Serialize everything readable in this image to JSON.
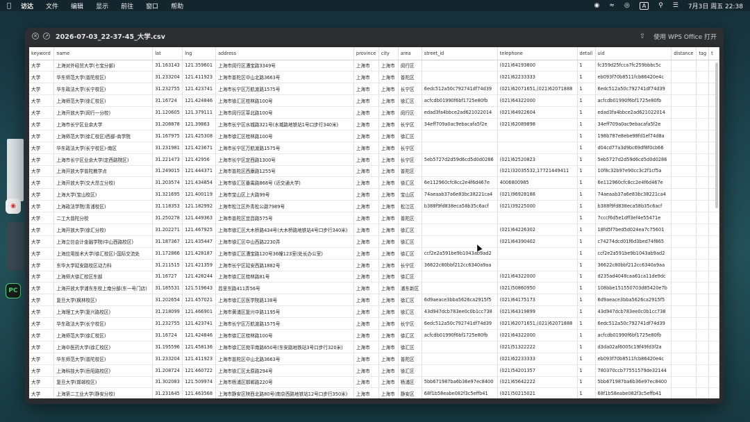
{
  "menubar": {
    "app": "访达",
    "items": [
      "文件",
      "编辑",
      "显示",
      "前往",
      "窗口",
      "帮助"
    ],
    "ime": "A",
    "clock": "7月3日 周五  22:38"
  },
  "window": {
    "title": "2026-07-03_22-37-45_大学.csv",
    "open_with": "使用 WPS Office 打开"
  },
  "table": {
    "columns": [
      "keyword",
      "name",
      "lat",
      "lng",
      "address",
      "province",
      "city",
      "area",
      "street_id",
      "telephone",
      "detail",
      "uid",
      "distance",
      "tag",
      "t"
    ],
    "rows": [
      [
        "大学",
        "上海对外经贸大学(七宝分部)",
        "31.163143",
        "121.359601",
        "上海市闵行区漕宝路3349号",
        "上海市",
        "上海市",
        "闵行区",
        "",
        "(021)64193800",
        "1",
        "fc359d25fcca7fc259bbbc5c",
        "",
        "",
        ""
      ],
      [
        "大学",
        "华东师范大学(普陀校区)",
        "31.233204",
        "121.411923",
        "上海市普陀区中山北路3663号",
        "上海市",
        "上海市",
        "普陀区",
        "",
        "(021)62233333",
        "1",
        "eb093f70b8511fcb86420e4c",
        "",
        "",
        ""
      ],
      [
        "大学",
        "华东政法大学(长宁校区)",
        "31.232755",
        "121.423741",
        "上海市长宁区万航渡路1575号",
        "上海市",
        "上海市",
        "长宁区",
        "6edc512a50c792741df74d39",
        "(021)62071651,(021)62071888",
        "1",
        "6edc512a50c792741df74d39",
        "",
        "",
        ""
      ],
      [
        "大学",
        "上海师范大学(徐汇校区)",
        "31.16724",
        "121.424846",
        "上海市徐汇区桂林路100号",
        "上海市",
        "上海市",
        "徐汇区",
        "acfcdb01990f6bf1725e80fb",
        "(021)64322000",
        "1",
        "acfcdb01990f6bf1725e80fb",
        "",
        "",
        ""
      ],
      [
        "大学",
        "上海开放大学(闵行一分校)",
        "31.120605",
        "121.379111",
        "上海市闵行区莘北路100号",
        "上海市",
        "上海市",
        "闵行区",
        "edad3fa4bbce2ad621022014",
        "(021)64922604",
        "1",
        "edad3fa4bbce2ad621022014",
        "",
        "",
        ""
      ],
      [
        "大学",
        "上海市长宁区业余大学",
        "31.208878",
        "121.39863",
        "上海市长宁区水城路321号(水城路地铁站1号口步行340米)",
        "上海市",
        "上海市",
        "长宁区",
        "34eff709a0ac9ebacafa5f2e",
        "(021)62089898",
        "1",
        "34eff709a0ac9ebacafa5f2e",
        "",
        "",
        ""
      ],
      [
        "大学",
        "上海师范大学(徐汇校区)西部-商学院",
        "31.167975",
        "121.425308",
        "上海市徐汇区桂林路100号",
        "上海市",
        "上海市",
        "徐汇区",
        "",
        "",
        "1",
        "198b787e8ebe98fd1ef74d8a",
        "",
        "",
        ""
      ],
      [
        "大学",
        "华东政法大学(长宁校区)-南区",
        "31.231981",
        "121.423671",
        "上海市长宁区万航渡路1575号",
        "上海市",
        "上海市",
        "长宁区",
        "",
        "",
        "1",
        "d04cd77a3d9bc69df8f0cb66",
        "",
        "",
        ""
      ],
      [
        "大学",
        "上海市长宁区业余大学(定西路院区)",
        "31.221473",
        "121.42956",
        "上海市长宁区定西路1300号",
        "上海市",
        "上海市",
        "长宁区",
        "5eb5727d2d59d6cd5d0d0286",
        "(021)62520823",
        "1",
        "5eb5727d2d59d6cd5d0d0286",
        "",
        "",
        ""
      ],
      [
        "大学",
        "上海开放大学普陀教学点",
        "31.249015",
        "121.444371",
        "上海市普陀区西康路1255号",
        "上海市",
        "上海市",
        "普陀区",
        "",
        "(021)32035532,17721449411",
        "1",
        "10f8c32b97e90cc3c2f1cf5a",
        "",
        "",
        ""
      ],
      [
        "大学",
        "上海开放大学(交大昂立分校)",
        "31.203574",
        "121.434854",
        "上海市徐汇区番禺路868号 (近交通大学)",
        "上海市",
        "上海市",
        "徐汇区",
        "6e112960cfc8cc2e4f6d467e",
        "4006800985",
        "1",
        "6e112960cfc8cc2e4f6d467e",
        "",
        "",
        ""
      ],
      [
        "大学",
        "上海大学(宝山校区)",
        "31.321695",
        "121.400119",
        "上海市宝山区上大路99号",
        "上海市",
        "上海市",
        "宝山区",
        "74aeaab37a6e83bc38221ca4",
        "(021)96928188",
        "1",
        "74aeaab37a6e83bc38221ca4",
        "",
        "",
        ""
      ],
      [
        "大学",
        "上海政法学院(青浦校区)",
        "31.118353",
        "121.182992",
        "上海市松江区外青松公路7989号",
        "上海市",
        "上海市",
        "松江区",
        "b388f9fd838eca58b35c6acf",
        "(021)39225000",
        "1",
        "b388f9fd838eca58b35c6acf",
        "",
        "",
        ""
      ],
      [
        "大学",
        "二工大普陀分校",
        "31.250278",
        "121.449363",
        "上海市普陀区宜昌路575号",
        "上海市",
        "上海市",
        "普陀区",
        "",
        "",
        "1",
        "7cccf6d5e1dff3ef4e55471e",
        "",
        "",
        ""
      ],
      [
        "大学",
        "上海开放大学(徐汇分校)",
        "31.202271",
        "121.467925",
        "上海市徐汇区大木桥路434号(大木桥路地铁站4号口步行340米)",
        "上海市",
        "上海市",
        "徐汇区",
        "",
        "(021)64226302",
        "1",
        "18fd5f7bed5d024ea7c75601",
        "",
        "",
        ""
      ],
      [
        "大学",
        "上海立信会计金融学院(中山西路校区)",
        "31.187367",
        "121.435447",
        "上海市徐汇区中山西路2230弄",
        "上海市",
        "上海市",
        "徐汇区",
        "",
        "(021)64390402",
        "1",
        "c74274dcd01f6d3bed74f865",
        "",
        "",
        ""
      ],
      [
        "大学",
        "上海应用技术大学(徐汇校区)-国际交流处",
        "31.172866",
        "121.428187",
        "上海市徐汇区漕宝路120号36幢123室(处长办公室)",
        "上海市",
        "上海市",
        "徐汇区",
        "ccf2e2a591be9b1043ab9ad2",
        "",
        "1",
        "ccf2e2a591be9b1043ab9ad2",
        "",
        "",
        ""
      ],
      [
        "大学",
        "东华大学延安路校区动力科",
        "31.211515",
        "121.421359",
        "上海市长宁区延安西路1882号",
        "上海市",
        "上海市",
        "长宁区",
        "36622c80bbf212cc6340a9aa",
        "",
        "1",
        "36622c80bbf212cc6340a9aa",
        "",
        "",
        ""
      ],
      [
        "大学",
        "上海师大徐汇校区东部",
        "31.16727",
        "121.428244",
        "上海市徐汇区桂林路81号",
        "上海市",
        "上海市",
        "徐汇区",
        "",
        "(021)64322000",
        "1",
        "d235ad4048caa61ca11de9dc",
        "",
        "",
        ""
      ],
      [
        "大学",
        "上海开放大学浦东东校上南分部(东一号门店)",
        "31.185531",
        "121.519643",
        "昌里东路411弄56号",
        "上海市",
        "上海市",
        "浦东新区",
        "",
        "(021)50860950",
        "1",
        "108bbe151550703d85420e7b",
        "",
        "",
        ""
      ],
      [
        "大学",
        "复旦大学(枫林校区)",
        "31.202654",
        "121.457021",
        "上海市徐汇区医学院路138号",
        "上海市",
        "上海市",
        "徐汇区",
        "6d9aeace3bba5626ca2915f5",
        "(021)64175173",
        "1",
        "6d9aeace3bba5626ca2915f5",
        "",
        "",
        ""
      ],
      [
        "大学",
        "上海理工大学(复兴路校区)",
        "31.218099",
        "121.466901",
        "上海市黄浦区复兴中路1195号",
        "上海市",
        "上海市",
        "徐汇区",
        "43d947dcb783ee0c0b1cc738",
        "(021)64319899",
        "1",
        "43d947dcb783ee0c0b1cc738",
        "",
        "",
        ""
      ],
      [
        "大学",
        "华东政法大学(长宁校区)",
        "31.232755",
        "121.423741",
        "上海市长宁区万航渡路1575号",
        "上海市",
        "上海市",
        "长宁区",
        "6edc512a50c792741df74d39",
        "(021)62071651,(021)62071888",
        "1",
        "6edc512a50c792741df74d39",
        "",
        "",
        ""
      ],
      [
        "大学",
        "上海师范大学(徐汇校区)",
        "31.16724",
        "121.424846",
        "上海市徐汇区桂林路100号",
        "上海市",
        "上海市",
        "徐汇区",
        "acfcdb01990f6bf1725e80fb",
        "(021)64322000",
        "1",
        "acfcdb01990f6bf1725e80fb",
        "",
        "",
        ""
      ],
      [
        "大学",
        "上海中医药大学(徐汇校区)",
        "31.195596",
        "121.458136",
        "上海市徐汇区宛平南路650号(东安路地铁站3号口步行320米)",
        "上海市",
        "上海市",
        "徐汇区",
        "",
        "(021)51322222",
        "1",
        "d3da02af6005c19f49fd3f2a",
        "",
        "",
        ""
      ],
      [
        "大学",
        "华东师范大学(普陀校区)",
        "31.233204",
        "121.411923",
        "上海市普陀区中山北路3663号",
        "上海市",
        "上海市",
        "普陀区",
        "",
        "(021)62233333",
        "1",
        "eb093f70b8511fcb86420e4c",
        "",
        "",
        ""
      ],
      [
        "大学",
        "上海科技大学(岳阳路校区)",
        "31.208724",
        "121.460722",
        "上海市徐汇区太原路294号",
        "上海市",
        "上海市",
        "徐汇区",
        "",
        "(021)54201357",
        "1",
        "780370ccb77551579de32144",
        "",
        "",
        ""
      ],
      [
        "大学",
        "复旦大学(邯郸校区)",
        "31.302083",
        "121.509974",
        "上海市杨浦区邯郸路220号",
        "上海市",
        "上海市",
        "杨浦区",
        "5bb671987ba6b36e97ec8400",
        "(021)65642222",
        "1",
        "5bb671987ba6b36e97ec8400",
        "",
        "",
        ""
      ],
      [
        "大学",
        "上海第二工业大学(静安分校)",
        "31.231645",
        "121.463568",
        "上海市静安区陕西北路80号(南京西路地铁站12号口步行350米)",
        "上海市",
        "上海市",
        "静安区",
        "68f1b58eabe082f3c5effb41",
        "(021)50215021",
        "1",
        "68f1b58eabe082f3c5effb41",
        "",
        "",
        ""
      ]
    ]
  }
}
